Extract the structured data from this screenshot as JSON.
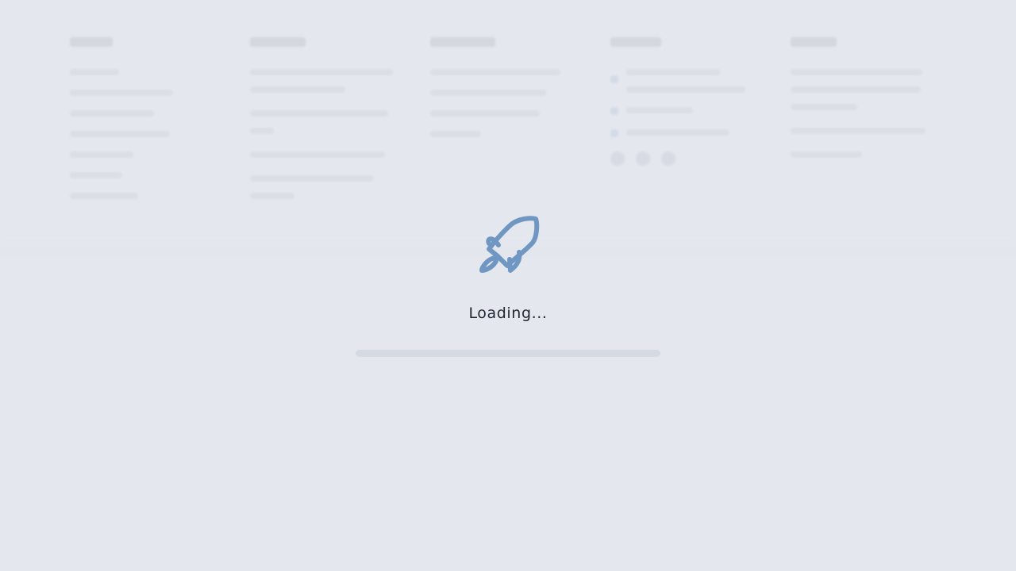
{
  "loading": {
    "text": "Loading...",
    "icon": "rocket-icon",
    "progress": 0
  },
  "colors": {
    "background": "#e4e7ee",
    "accent": "#6f97c2",
    "text": "#1f2833"
  }
}
